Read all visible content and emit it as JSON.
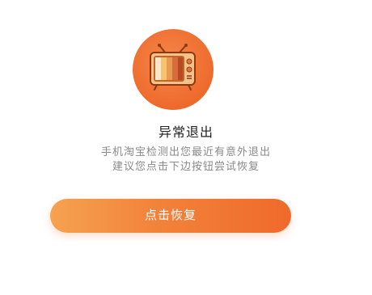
{
  "dialog": {
    "icon": "retro-tv-icon",
    "title": "异常退出",
    "message_line1": "手机淘宝检测出您最近有意外退出",
    "message_line2": "建议您点击下边按钮尝试恢复",
    "restore_button_label": "点击恢复"
  },
  "colors": {
    "accent": "#EF6A2B",
    "button_gradient_start": "#F6A250",
    "button_gradient_end": "#EF6A2B",
    "title": "#222222",
    "message": "#8A8A8A"
  }
}
